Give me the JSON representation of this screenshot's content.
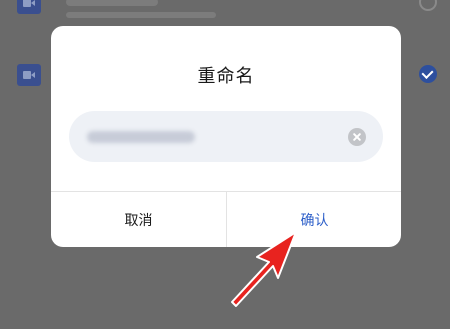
{
  "background_list": {
    "rows": [
      {
        "icon": "video-icon",
        "state": "unselected"
      },
      {
        "icon": "video-icon",
        "state": "selected"
      }
    ]
  },
  "dialog": {
    "title": "重命名",
    "name_input": {
      "value": "",
      "placeholder": ""
    },
    "clear_icon": "close-circle-icon",
    "cancel_label": "取消",
    "confirm_label": "确认"
  },
  "colors": {
    "accent": "#2d5fc9",
    "annotation_arrow": "#e8231f",
    "overlay": "#6a6a6a"
  }
}
